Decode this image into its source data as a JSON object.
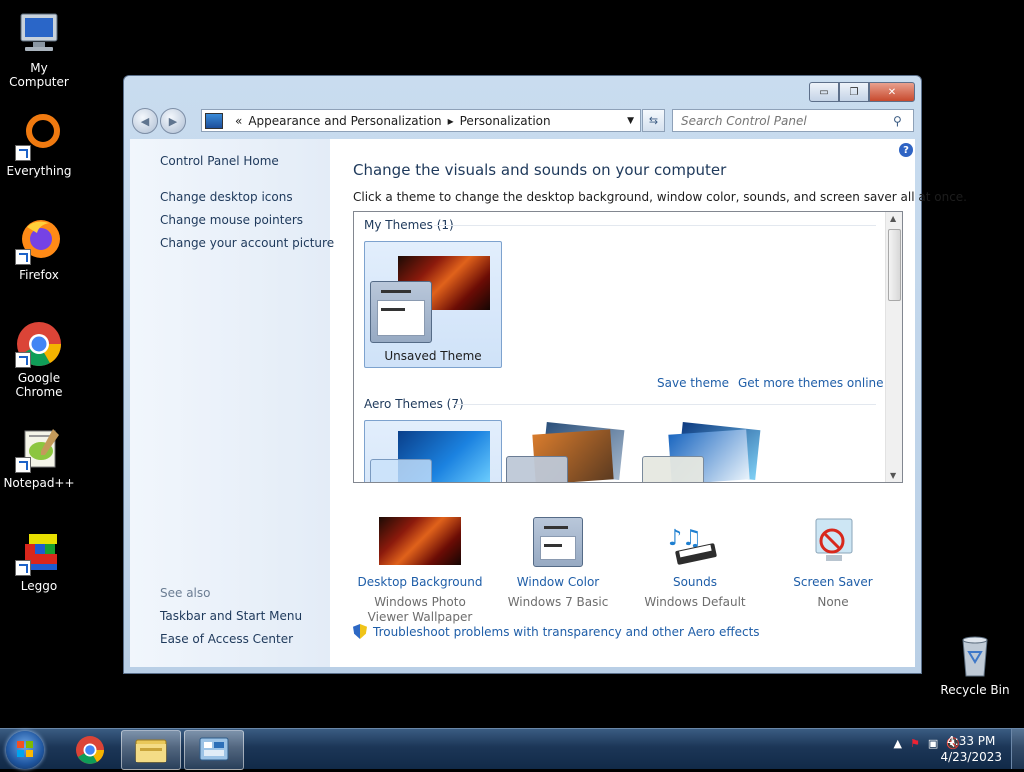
{
  "desktop": {
    "icons": [
      {
        "label": "My Computer",
        "icon": "computer-icon"
      },
      {
        "label": "Everything",
        "icon": "everything-icon"
      },
      {
        "label": "Firefox",
        "icon": "firefox-icon"
      },
      {
        "label": "Google Chrome",
        "icon": "chrome-icon"
      },
      {
        "label": "Notepad++",
        "icon": "notepadpp-icon"
      },
      {
        "label": "Leggo",
        "icon": "leggo-icon"
      }
    ],
    "recycle_bin": "Recycle Bin"
  },
  "window": {
    "controls": {
      "minimize": "▭",
      "maximize": "❐",
      "close": "✕"
    },
    "address": {
      "prefix": "«",
      "crumbs": [
        "Appearance and Personalization",
        "Personalization"
      ]
    },
    "search_placeholder": "Search Control Panel"
  },
  "sidebar": {
    "home": "Control Panel Home",
    "links": [
      "Change desktop icons",
      "Change mouse pointers",
      "Change your account picture"
    ],
    "see_also_heading": "See also",
    "see_also": [
      "Taskbar and Start Menu",
      "Ease of Access Center"
    ]
  },
  "main": {
    "title": "Change the visuals and sounds on your computer",
    "description": "Click a theme to change the desktop background, window color, sounds, and screen saver all at once.",
    "my_themes_heading": "My Themes (1)",
    "unsaved_theme": "Unsaved Theme",
    "save_theme": "Save theme",
    "get_more": "Get more themes online",
    "aero_heading": "Aero Themes (7)"
  },
  "settings": [
    {
      "label": "Desktop Background",
      "sub": "Windows Photo Viewer Wallpaper"
    },
    {
      "label": "Window Color",
      "sub": "Windows 7 Basic"
    },
    {
      "label": "Sounds",
      "sub": "Windows Default"
    },
    {
      "label": "Screen Saver",
      "sub": "None"
    }
  ],
  "troubleshoot": "Troubleshoot problems with transparency and other Aero effects",
  "taskbar": {
    "time": "4:33 PM",
    "date": "4/23/2023"
  },
  "colors": {
    "link": "#1f5ea8",
    "heading": "#1e395b",
    "taskbar": "#1c3657"
  }
}
